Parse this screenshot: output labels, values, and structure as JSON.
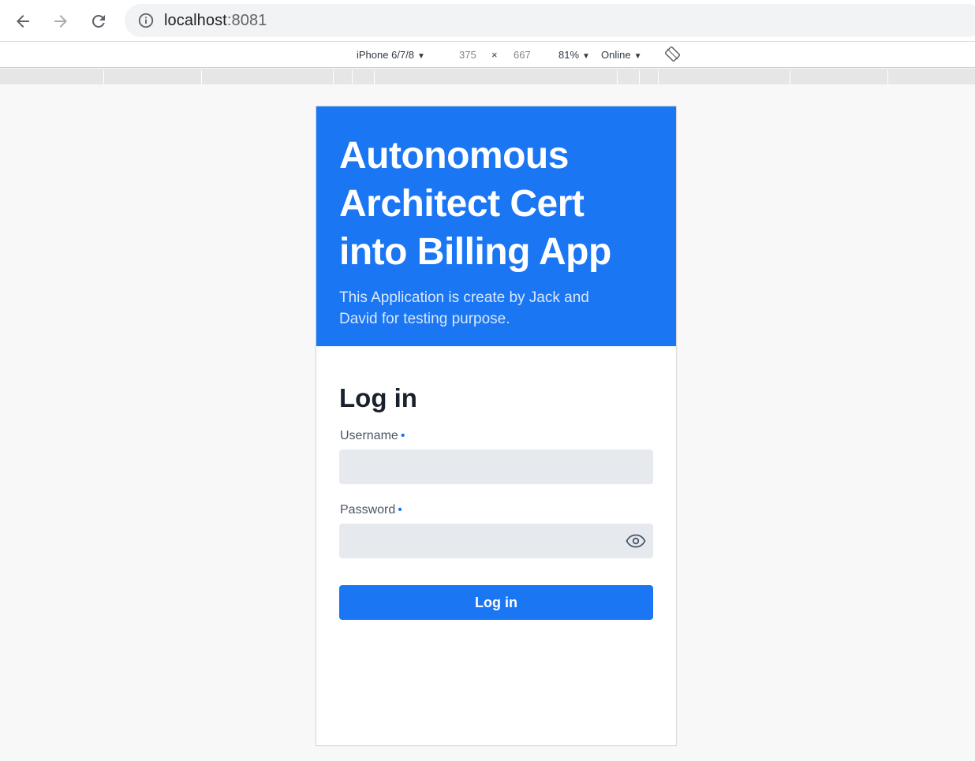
{
  "browser": {
    "url_host": "localhost",
    "url_port": ":8081",
    "back_icon": "arrow-left-icon",
    "forward_icon": "arrow-right-icon",
    "reload_icon": "reload-icon",
    "info_icon": "info-icon"
  },
  "device_toolbar": {
    "device": "iPhone 6/7/8",
    "width": "375",
    "times": "×",
    "height": "667",
    "zoom": "81%",
    "throttle": "Online",
    "rotate_icon": "rotate-icon"
  },
  "app": {
    "accent_color": "#1a76f2",
    "hero": {
      "title_line1": "Autonomous",
      "title_line2": "Architect Cert",
      "title_line3": "into Billing App",
      "subtitle": "This Application is create by Jack and David for testing purpose."
    },
    "login": {
      "heading": "Log in",
      "username_label": "Username",
      "password_label": "Password",
      "required_marker": "•",
      "username_value": "",
      "password_value": "",
      "eye_icon": "eye-icon",
      "submit_label": "Log in"
    }
  }
}
